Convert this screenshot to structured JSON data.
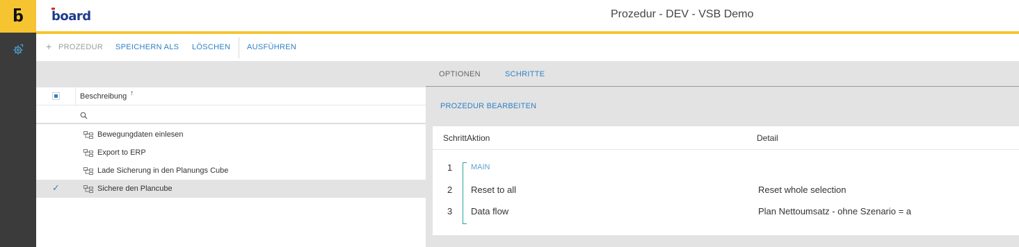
{
  "window": {
    "title": "Prozedur - DEV - VSB Demo"
  },
  "brand": {
    "logo_text": "board"
  },
  "rail": {
    "logo_letter": "b",
    "items": [
      {
        "icon": "process-gear-icon"
      }
    ]
  },
  "toolbar": {
    "new_label": "PROZEDUR",
    "save_as_label": "SPEICHERN ALS",
    "delete_label": "LÖSCHEN",
    "run_label": "AUSFÜHREN"
  },
  "left_panel": {
    "column_header": "Beschreibung",
    "sort_indicator": "↑",
    "search": {
      "placeholder": "",
      "value": ""
    },
    "items": [
      {
        "label": "Bewegungdaten einlesen",
        "selected": false
      },
      {
        "label": "Export to ERP",
        "selected": false
      },
      {
        "label": "Lade Sicherung in den Planungs Cube",
        "selected": false
      },
      {
        "label": "Sichere den Plancube",
        "selected": true
      }
    ],
    "check_mark": "✓"
  },
  "right_panel": {
    "tabs": [
      {
        "label": "OPTIONEN",
        "active": false
      },
      {
        "label": "SCHRITTE",
        "active": true
      }
    ],
    "edit_link": "PROZEDUR BEARBEITEN",
    "columns": {
      "step_action": "SchrittAktion",
      "detail": "Detail"
    },
    "steps": [
      {
        "number": "1",
        "action": "MAIN",
        "detail": ""
      },
      {
        "number": "2",
        "action": "Reset to all",
        "detail": "Reset whole selection"
      },
      {
        "number": "3",
        "action": "Data flow",
        "detail": "Plan Nettoumsatz - ohne Szenario = a"
      }
    ]
  },
  "colors": {
    "accent_yellow": "#f6c431",
    "rail_dark": "#3b3b3b",
    "link_blue": "#2f80c6",
    "bracket_teal": "#2aa2a0"
  }
}
